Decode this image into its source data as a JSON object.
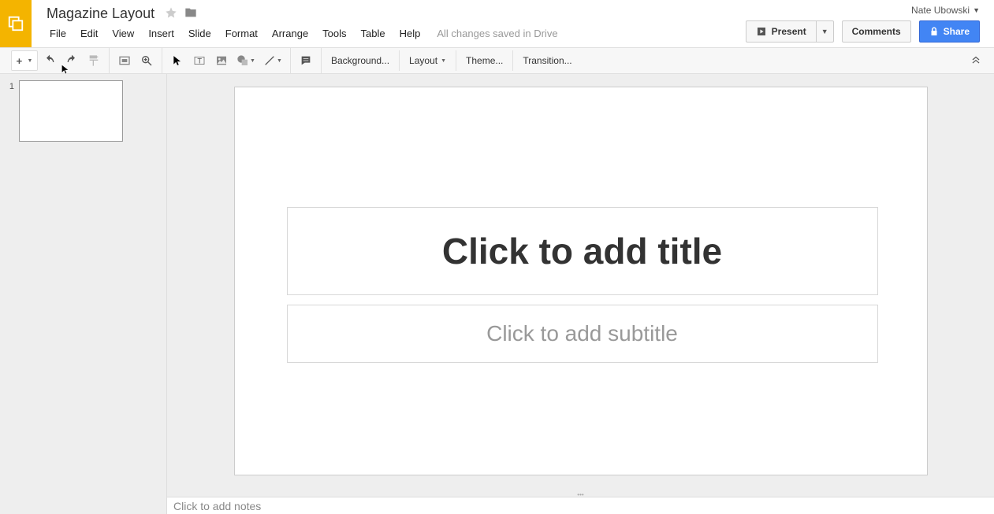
{
  "header": {
    "doc_title": "Magazine Layout",
    "user_name": "Nate Ubowski",
    "menus": [
      "File",
      "Edit",
      "View",
      "Insert",
      "Slide",
      "Format",
      "Arrange",
      "Tools",
      "Table",
      "Help"
    ],
    "save_status": "All changes saved in Drive",
    "present_label": "Present",
    "comments_label": "Comments",
    "share_label": "Share"
  },
  "toolbar": {
    "background_label": "Background...",
    "layout_label": "Layout",
    "theme_label": "Theme...",
    "transition_label": "Transition..."
  },
  "slide_panel": {
    "slides": [
      {
        "number": "1"
      }
    ]
  },
  "canvas": {
    "title_placeholder": "Click to add title",
    "subtitle_placeholder": "Click to add subtitle"
  },
  "notes": {
    "placeholder": "Click to add notes"
  }
}
